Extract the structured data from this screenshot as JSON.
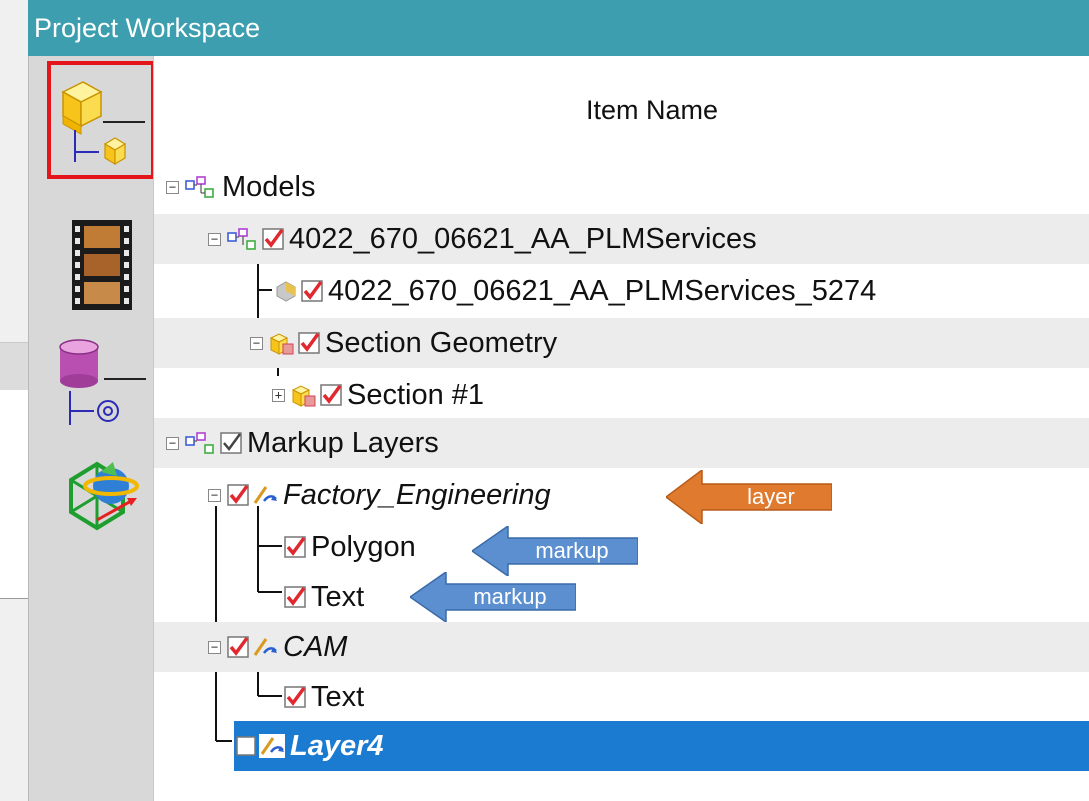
{
  "window": {
    "title": "Project Workspace"
  },
  "tree": {
    "column_header": "Item Name",
    "rows": [
      {
        "label": "Models"
      },
      {
        "label": "4022_670_06621_AA_PLMServices"
      },
      {
        "label": "4022_670_06621_AA_PLMServices_5274"
      },
      {
        "label": "Section Geometry"
      },
      {
        "label": "Section #1"
      },
      {
        "label": "Markup Layers"
      },
      {
        "label": "Factory_Engineering"
      },
      {
        "label": "Polygon"
      },
      {
        "label": "Text"
      },
      {
        "label": "CAM"
      },
      {
        "label": "Text"
      },
      {
        "label": "Layer4"
      }
    ]
  },
  "annotations": {
    "layer": "layer",
    "markup_polygon": "markup",
    "markup_text": "markup"
  },
  "colors": {
    "title_bar": "#3c9eae",
    "selection": "#1a7bd1",
    "highlight_border": "#e4151b",
    "arrow_orange": "#e07a2e",
    "arrow_blue": "#5b8fd0"
  },
  "icons": {
    "toolbar": [
      "model-tree-icon",
      "animation-filmstrip-icon",
      "database-tree-icon",
      "globe-network-icon"
    ]
  }
}
